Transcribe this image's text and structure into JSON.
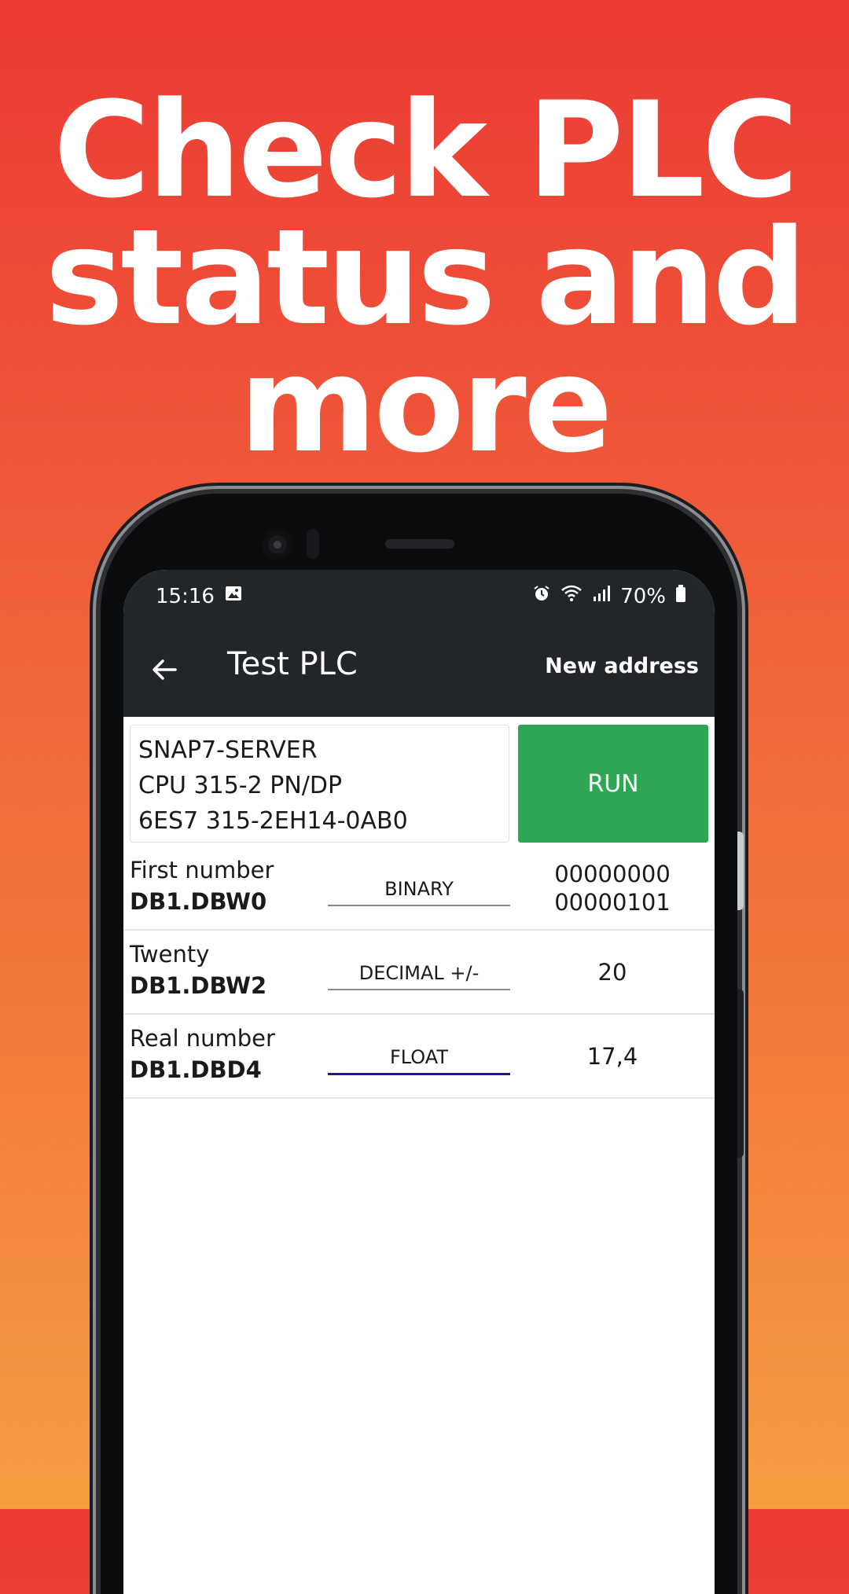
{
  "headline": {
    "line1": "Check PLC",
    "line2": "status and",
    "line3": "more"
  },
  "statusbar": {
    "time": "15:16",
    "battery": "70%",
    "icons": [
      "image-icon",
      "alarm-icon",
      "wifi-icon",
      "signal-icon",
      "battery-icon"
    ]
  },
  "appbar": {
    "title": "Test PLC",
    "action": "New address"
  },
  "plc": {
    "server": "SNAP7-SERVER",
    "cpu": "CPU 315-2 PN/DP",
    "order_number": "6ES7 315-2EH14-0AB0",
    "state": "RUN",
    "state_color": "#2ea653"
  },
  "variables": [
    {
      "name": "First number",
      "address": "DB1.DBW0",
      "format": "BINARY",
      "value_line1": "00000000",
      "value_line2": "00000101"
    },
    {
      "name": "Twenty",
      "address": "DB1.DBW2",
      "format": "DECIMAL +/-",
      "value_line1": "20",
      "value_line2": ""
    },
    {
      "name": "Real number",
      "address": "DB1.DBD4",
      "format": "FLOAT",
      "value_line1": "17,4",
      "value_line2": ""
    }
  ],
  "colors": {
    "appbar": "#22262b",
    "accent_underline": "#1f1a8c"
  }
}
